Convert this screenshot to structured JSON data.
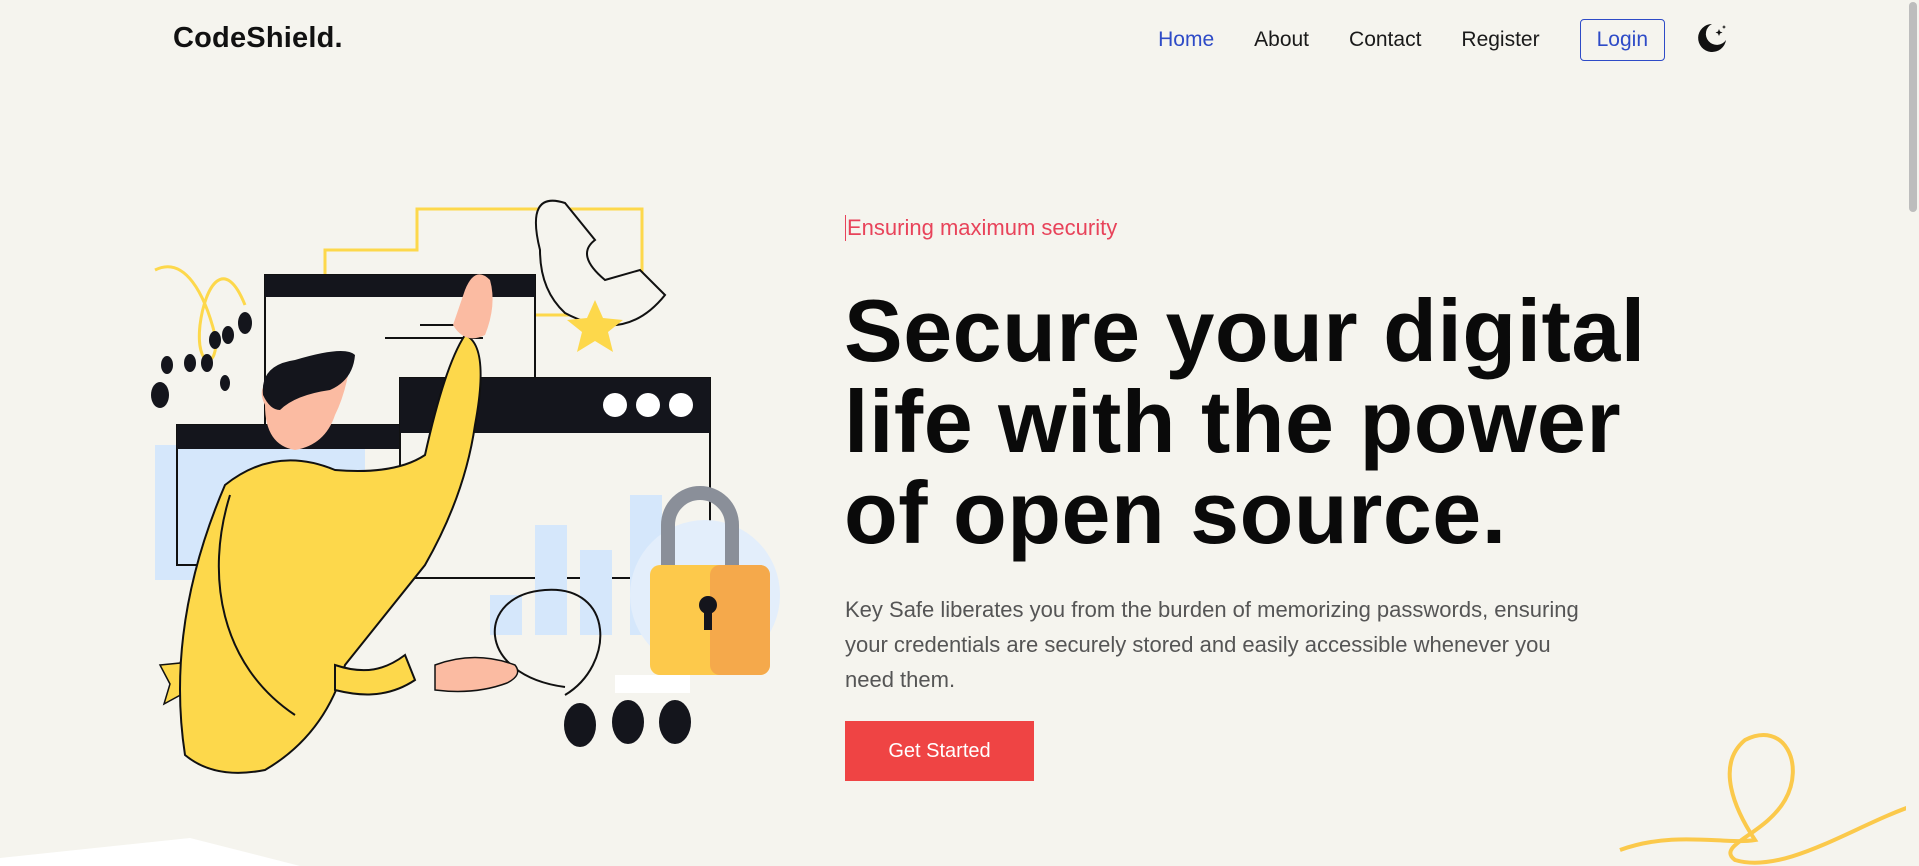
{
  "header": {
    "brand": "CodeShield.",
    "nav": [
      {
        "label": "Home",
        "active": true
      },
      {
        "label": "About",
        "active": false
      },
      {
        "label": "Contact",
        "active": false
      },
      {
        "label": "Register",
        "active": false
      }
    ],
    "login_label": "Login",
    "theme_icon": "moon-stars-icon"
  },
  "hero": {
    "eyebrow": "Ensuring maximum security",
    "headline_lines": [
      "Secure your digital",
      "life with the power",
      "of open source."
    ],
    "lead": "Key Safe liberates you from the burden of memorizing passwords, ensuring your credentials are securely stored and easily accessible whenever you need them.",
    "cta_label": "Get Started",
    "illustration_icon": "person-with-padlock-illustration"
  },
  "colors": {
    "background": "#f5f4ee",
    "accent_blue": "#2e4bc7",
    "accent_red": "#ef4444",
    "eyebrow_pink": "#e8435a",
    "illustration_yellow": "#fdd84b"
  }
}
